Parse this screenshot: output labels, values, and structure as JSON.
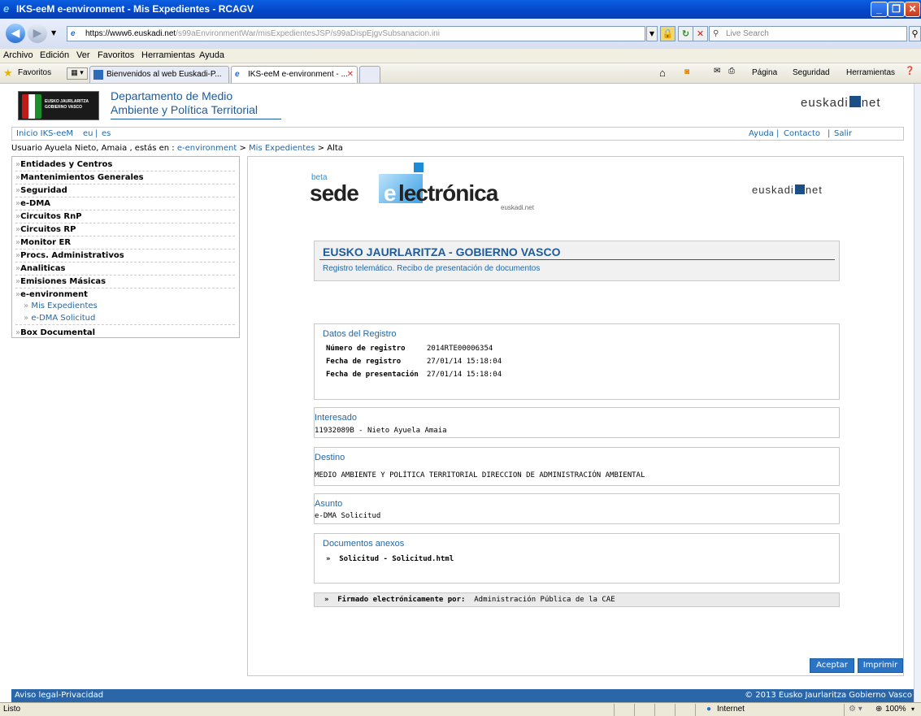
{
  "window": {
    "title": "IKS-eeM e-environment - Mis Expedientes - RCAGV"
  },
  "address": {
    "host": "https://www6.euskadi.net",
    "path": "/s99aEnvironmentWar/misExpedientesJSP/s99aDispEjgvSubsanacion.ini"
  },
  "search": {
    "placeholder": "Live Search"
  },
  "menu": {
    "archivo": "Archivo",
    "edicion": "Edición",
    "ver": "Ver",
    "favoritos": "Favoritos",
    "herramientas": "Herramientas",
    "ayuda": "Ayuda"
  },
  "favbar": {
    "favoritos": "Favoritos",
    "tab1": "Bienvenidos al web Euskadi-P...",
    "tab2": "IKS-eeM e-environment - ...",
    "pagina": "Página",
    "seguridad": "Seguridad",
    "herramientas": "Herramientas"
  },
  "site": {
    "logo_line1": "EUSKO JAURLARITZA",
    "logo_line2": "GOBIERNO VASCO",
    "dept_line1": "Departamento de Medio",
    "dept_line2": "Ambiente y Política Territorial",
    "euskadi_a": "euskadi",
    "euskadi_b": "net"
  },
  "linkbar": {
    "inicio": "Inicio IKS-eeM",
    "eu": "eu",
    "sep": "|",
    "es": "es",
    "ayuda": "Ayuda",
    "contacto": "Contacto",
    "salir": "Salir"
  },
  "breadcrumb": {
    "prefix": "Usuario Ayuela Nieto, Amaia , estás en :",
    "link1": "e-environment",
    "gt": ">",
    "link2": "Mis Expedientes",
    "last": "> Alta"
  },
  "sidebar": {
    "items": [
      "Entidades y Centros",
      "Mantenimientos Generales",
      "Seguridad",
      "e-DMA",
      "Circuitos RnP",
      "Circuitos RP",
      "Monitor ER",
      "Procs. Administrativos",
      "Analiticas",
      "Emisiones Másicas",
      "e-environment"
    ],
    "subitems": [
      "Mis Expedientes",
      "e-DMA Solicitud"
    ],
    "last": "Box Documental",
    "arrow": "»"
  },
  "sede": {
    "beta": "beta",
    "sede": "sede",
    "e": "e",
    "electronica": "lectrónica",
    "sub": "euskadi.net"
  },
  "receipt": {
    "org": "EUSKO JAURLARITZA - GOBIERNO VASCO",
    "subtitle": "Registro telemático. Recibo de presentación de documentos",
    "datos_title": "Datos del Registro",
    "num_label": "Número de registro",
    "num_value": "2014RTE00006354",
    "fecha_label": "Fecha de registro",
    "fecha_value": "27/01/14 15:18:04",
    "pres_label": "Fecha de presentación",
    "pres_value": "27/01/14 15:18:04",
    "interesado_title": "Interesado",
    "interesado_value": "11932089B - Nieto Ayuela Amaia",
    "destino_title": "Destino",
    "destino_value": "MEDIO AMBIENTE Y POLÍTICA TERRITORIAL  DIRECCION DE ADMINISTRACIÓN AMBIENTAL",
    "asunto_title": "Asunto",
    "asunto_value": "e-DMA Solicitud",
    "docs_title": "Documentos anexos",
    "doc_item": "Solicitud - Solicitud.html",
    "firmado_label": "Firmado electrónicamente por:",
    "firmado_value": "Administración Pública de la CAE",
    "bullet": "»"
  },
  "buttons": {
    "aceptar": "Aceptar",
    "imprimir": "Imprimir"
  },
  "footer": {
    "left": "Aviso legal-Privacidad",
    "right": "© 2013 Eusko Jaurlaritza Gobierno Vasco"
  },
  "status": {
    "left": "Listo",
    "zone": "Internet",
    "zoom": "100%"
  }
}
